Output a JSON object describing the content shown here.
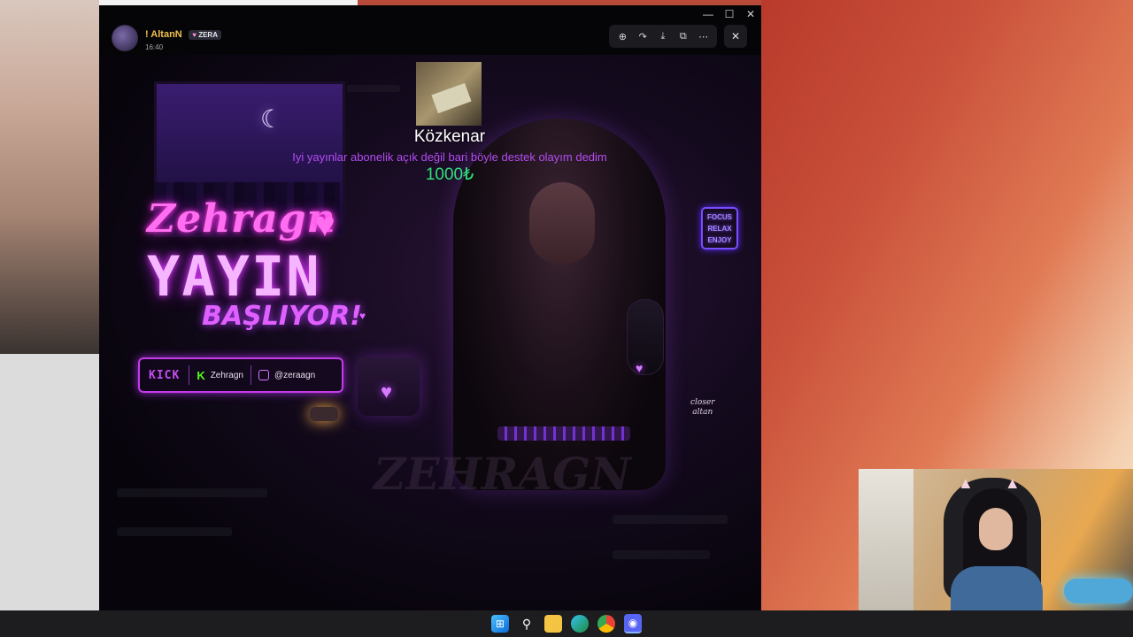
{
  "viewer": {
    "user_name": "! AltanN",
    "user_badge": "ZERA",
    "user_badge_icon": "heart-icon",
    "time": "16:40",
    "toolbar_icons": [
      "zoom-in-icon",
      "forward-icon",
      "download-icon",
      "open-external-icon",
      "more-icon"
    ],
    "toolbar_glyphs": [
      "⊕",
      "↷",
      "⤓",
      "⧉",
      "⋯"
    ],
    "close_glyph": "✕",
    "window_controls": [
      "—",
      "☐",
      "✕"
    ]
  },
  "poster": {
    "name": "Zehragn",
    "headline": "YAYIN",
    "subline": "BAŞLIYOR!",
    "social": {
      "kick": "KICK",
      "kick_name": "Zehragn",
      "instagram": "@zeraagn"
    },
    "focus_sign": [
      "FOCUS",
      "RELAX",
      "ENJOY"
    ],
    "signature": [
      "closer",
      "altan"
    ],
    "watermark": "ZEHRAGN"
  },
  "donation": {
    "donor": "Közkenar",
    "message": "Iyi yayınlar abonelik açık değil bari böyle destek olayım dedim",
    "amount": "1000₺"
  },
  "taskbar": {
    "apps": [
      "windows-start-icon",
      "search-icon",
      "file-explorer-icon",
      "edge-icon",
      "chrome-icon",
      "discord-icon"
    ]
  },
  "colors": {
    "neon_pink": "#ff6ef0",
    "donation_message": "#b44cf2",
    "donation_amount": "#2fe07a",
    "kick_green": "#53fc18"
  }
}
